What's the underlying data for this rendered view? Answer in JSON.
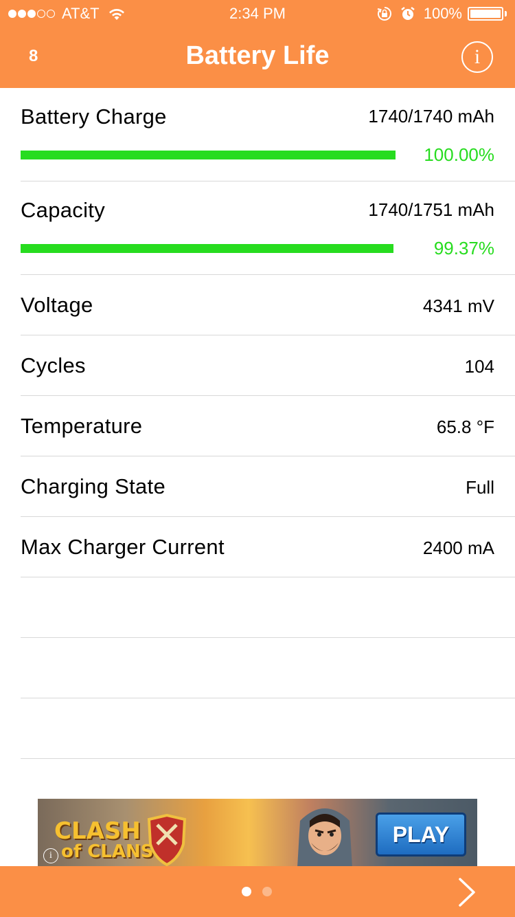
{
  "status_bar": {
    "signal_filled": 3,
    "signal_total": 5,
    "carrier": "AT&T",
    "time": "2:34 PM",
    "battery_percent": "100%",
    "battery_level": 1.0,
    "icons": [
      "wifi-icon",
      "rotation-lock-icon",
      "alarm-icon",
      "battery-icon"
    ]
  },
  "nav": {
    "badge": "8",
    "title": "Battery Life",
    "info_icon": "info-icon"
  },
  "rows": [
    {
      "label": "Battery Charge",
      "value": "1740/1740 mAh",
      "percent": "100.00%",
      "bar_fraction": 1.0
    },
    {
      "label": "Capacity",
      "value": "1740/1751 mAh",
      "percent": "99.37%",
      "bar_fraction": 0.9937
    },
    {
      "label": "Voltage",
      "value": "4341 mV"
    },
    {
      "label": "Cycles",
      "value": "104"
    },
    {
      "label": "Temperature",
      "value": "65.8 °F"
    },
    {
      "label": "Charging State",
      "value": "Full"
    },
    {
      "label": "Max Charger Current",
      "value": "2400 mA"
    }
  ],
  "ad": {
    "logo_line1": "CLASH",
    "logo_line2": "of CLANS",
    "button": "PLAY"
  },
  "pager": {
    "pages": 2,
    "current": 1
  },
  "colors": {
    "accent": "#fb8f46",
    "bar_green": "#27dc1f",
    "divider": "#d8d8d8",
    "dot_active": "#ffffff",
    "dot_inactive": "#fbb88a"
  }
}
